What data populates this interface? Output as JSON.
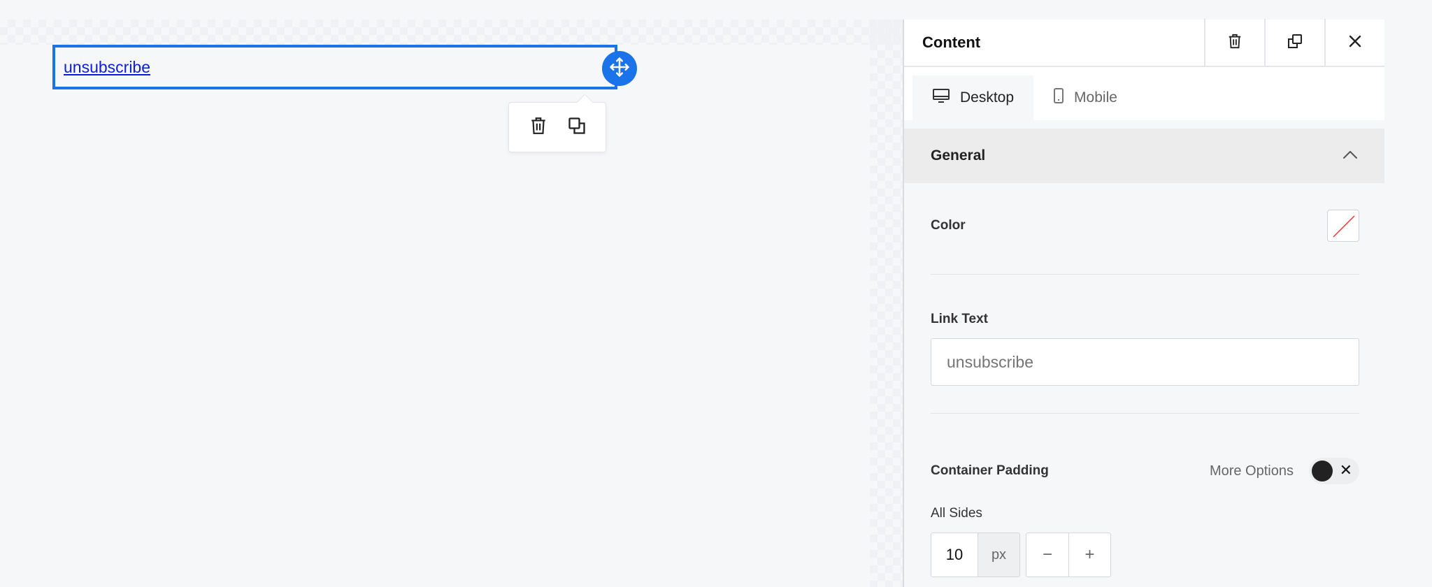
{
  "canvas": {
    "link_text": "unsubscribe"
  },
  "panel": {
    "title": "Content",
    "tabs": [
      {
        "label": "Desktop",
        "icon": "desktop-icon",
        "active": true
      },
      {
        "label": "Mobile",
        "icon": "mobile-icon",
        "active": false
      }
    ],
    "section": {
      "title": "General",
      "expanded": true
    },
    "color": {
      "label": "Color",
      "value": "none"
    },
    "link_text": {
      "label": "Link Text",
      "placeholder": "unsubscribe"
    },
    "container_padding": {
      "label": "Container Padding",
      "more_options_label": "More Options",
      "toggle_on": false,
      "all_sides_label": "All Sides",
      "value": "10",
      "unit": "px",
      "decrement_label": "−",
      "increment_label": "+"
    }
  },
  "colors": {
    "accent": "#1a73e8",
    "link": "#0b1fd8"
  }
}
